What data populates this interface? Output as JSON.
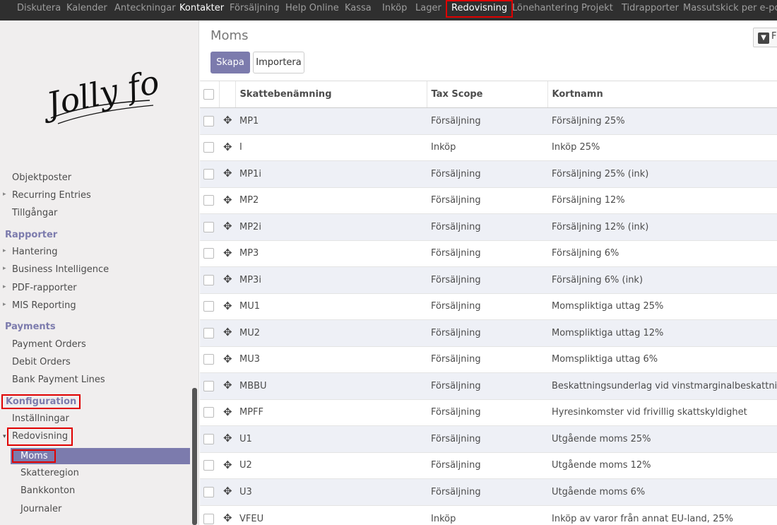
{
  "topnav": {
    "items": [
      {
        "label": "Diskutera"
      },
      {
        "label": "Kalender"
      },
      {
        "label": "Anteckningar"
      },
      {
        "label": "Kontakter"
      },
      {
        "label": "Försäljning"
      },
      {
        "label": "Help Online"
      },
      {
        "label": "Kassa"
      },
      {
        "label": "Inköp"
      },
      {
        "label": "Lager"
      },
      {
        "label": "Redovisning"
      },
      {
        "label": "Lönehantering"
      },
      {
        "label": "Projekt"
      },
      {
        "label": "Tidrapporter"
      },
      {
        "label": "Massutskick per e-post"
      }
    ]
  },
  "sidebar": {
    "logo_text": "Jolly food",
    "items": {
      "objektposter": "Objektposter",
      "recurring": "Recurring Entries",
      "tillgangar": "Tillgångar",
      "rapporter_header": "Rapporter",
      "hantering": "Hantering",
      "bi": "Business Intelligence",
      "pdf": "PDF-rapporter",
      "mis": "MIS Reporting",
      "payments_header": "Payments",
      "payment_orders": "Payment Orders",
      "debit_orders": "Debit Orders",
      "bank_payment_lines": "Bank Payment Lines",
      "konfiguration_header": "Konfiguration",
      "installningar": "Inställningar",
      "redovisning": "Redovisning",
      "moms": "Moms",
      "skatteregion": "Skatteregion",
      "bankkonton": "Bankkonton",
      "journaler": "Journaler"
    },
    "caret_right": "▸",
    "caret_down": "▾"
  },
  "main": {
    "title": "Moms",
    "create_label": "Skapa",
    "import_label": "Importera",
    "filter_label": "F",
    "columns": [
      "Skattebenämning",
      "Tax Scope",
      "Kortnamn"
    ],
    "rows": [
      [
        "MP1",
        "Försäljning",
        "Försäljning 25%"
      ],
      [
        "I",
        "Inköp",
        "Inköp 25%"
      ],
      [
        "MP1i",
        "Försäljning",
        "Försäljning 25% (ink)"
      ],
      [
        "MP2",
        "Försäljning",
        "Försäljning 12%"
      ],
      [
        "MP2i",
        "Försäljning",
        "Försäljning 12% (ink)"
      ],
      [
        "MP3",
        "Försäljning",
        "Försäljning 6%"
      ],
      [
        "MP3i",
        "Försäljning",
        "Försäljning 6% (ink)"
      ],
      [
        "MU1",
        "Försäljning",
        "Momspliktiga uttag 25%"
      ],
      [
        "MU2",
        "Försäljning",
        "Momspliktiga uttag 12%"
      ],
      [
        "MU3",
        "Försäljning",
        "Momspliktiga uttag 6%"
      ],
      [
        "MBBU",
        "Försäljning",
        "Beskattningsunderlag vid vinstmarginalbeskattning"
      ],
      [
        "MPFF",
        "Försäljning",
        "Hyresinkomster vid frivillig skattskyldighet"
      ],
      [
        "U1",
        "Försäljning",
        "Utgående moms 25%"
      ],
      [
        "U2",
        "Försäljning",
        "Utgående moms 12%"
      ],
      [
        "U3",
        "Försäljning",
        "Utgående moms 6%"
      ],
      [
        "VFEU",
        "Inköp",
        "Inköp av varor från annat EU-land, 25%"
      ]
    ]
  },
  "colors": {
    "accent": "#7c7bad",
    "topbar": "#2f2f2f",
    "highlight_border": "#e00000",
    "row_alt": "#eef0f6"
  }
}
